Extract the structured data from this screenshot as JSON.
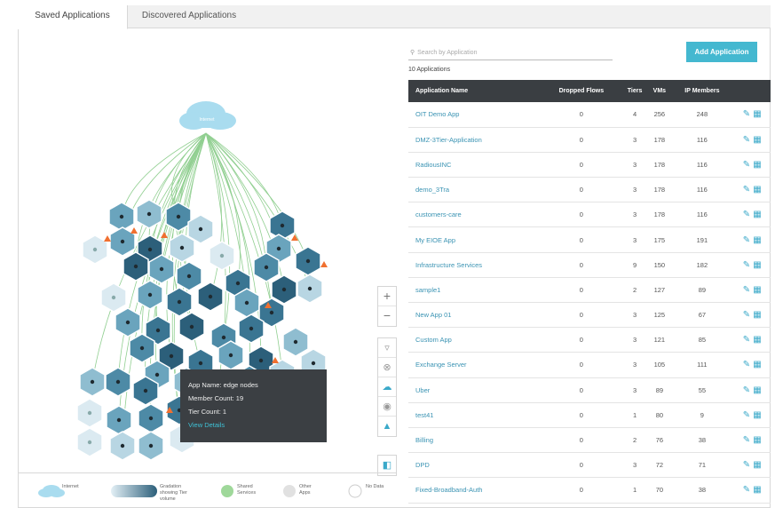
{
  "tabs": [
    {
      "label": "Saved Applications",
      "active": true
    },
    {
      "label": "Discovered Applications",
      "active": false
    }
  ],
  "search": {
    "placeholder": "Search by Application"
  },
  "add_button": "Add Application",
  "count_label": "10 Applications",
  "columns": [
    "Application Name",
    "Dropped Flows",
    "Tiers",
    "VMs",
    "IP Members"
  ],
  "rows": [
    {
      "name": "OIT Demo App",
      "dropped": "0",
      "tiers": "4",
      "vms": "256",
      "ip": "248"
    },
    {
      "name": "DMZ-3Tier-Application",
      "dropped": "0",
      "tiers": "3",
      "vms": "178",
      "ip": "116"
    },
    {
      "name": "RadiousINC",
      "dropped": "0",
      "tiers": "3",
      "vms": "178",
      "ip": "116"
    },
    {
      "name": "demo_3Tra",
      "dropped": "0",
      "tiers": "3",
      "vms": "178",
      "ip": "116"
    },
    {
      "name": "customers-care",
      "dropped": "0",
      "tiers": "3",
      "vms": "178",
      "ip": "116"
    },
    {
      "name": "My EIOE App",
      "dropped": "0",
      "tiers": "3",
      "vms": "175",
      "ip": "191"
    },
    {
      "name": "Infrastructure Services",
      "dropped": "0",
      "tiers": "9",
      "vms": "150",
      "ip": "182"
    },
    {
      "name": "sample1",
      "dropped": "0",
      "tiers": "2",
      "vms": "127",
      "ip": "89"
    },
    {
      "name": "New App 01",
      "dropped": "0",
      "tiers": "3",
      "vms": "125",
      "ip": "67"
    },
    {
      "name": "Custom App",
      "dropped": "0",
      "tiers": "3",
      "vms": "121",
      "ip": "85"
    },
    {
      "name": "Exchange Server",
      "dropped": "0",
      "tiers": "3",
      "vms": "105",
      "ip": "111"
    },
    {
      "name": "Uber",
      "dropped": "0",
      "tiers": "3",
      "vms": "89",
      "ip": "55"
    },
    {
      "name": "test41",
      "dropped": "0",
      "tiers": "1",
      "vms": "80",
      "ip": "9"
    },
    {
      "name": "Billing",
      "dropped": "0",
      "tiers": "2",
      "vms": "76",
      "ip": "38"
    },
    {
      "name": "DPD",
      "dropped": "0",
      "tiers": "3",
      "vms": "72",
      "ip": "71"
    },
    {
      "name": "Fixed-Broadband-Auth",
      "dropped": "0",
      "tiers": "1",
      "vms": "70",
      "ip": "38"
    }
  ],
  "graph": {
    "cloud_label": "Internet",
    "zoom_in": "+",
    "zoom_out": "−",
    "tools": [
      "filter-icon",
      "close-circle-icon",
      "cloud-icon",
      "settings-icon",
      "alert-icon",
      "panel-icon"
    ]
  },
  "tooltip": {
    "app_name": "App Name: edge nodes",
    "member_count": "Member Count: 19",
    "tier_count": "Tier Count: 1",
    "link": "View Details"
  },
  "legend": [
    {
      "label": "Internet"
    },
    {
      "label": "Gradation showing Tier volume"
    },
    {
      "label": "Shared Services"
    },
    {
      "label": "Other Apps"
    },
    {
      "label": "No Data"
    }
  ],
  "colors": {
    "accent": "#44b8d0",
    "header_dark": "#3a3e42",
    "link": "#3a93b3",
    "flow_green": "#5cb85c",
    "alert": "#f07030"
  }
}
